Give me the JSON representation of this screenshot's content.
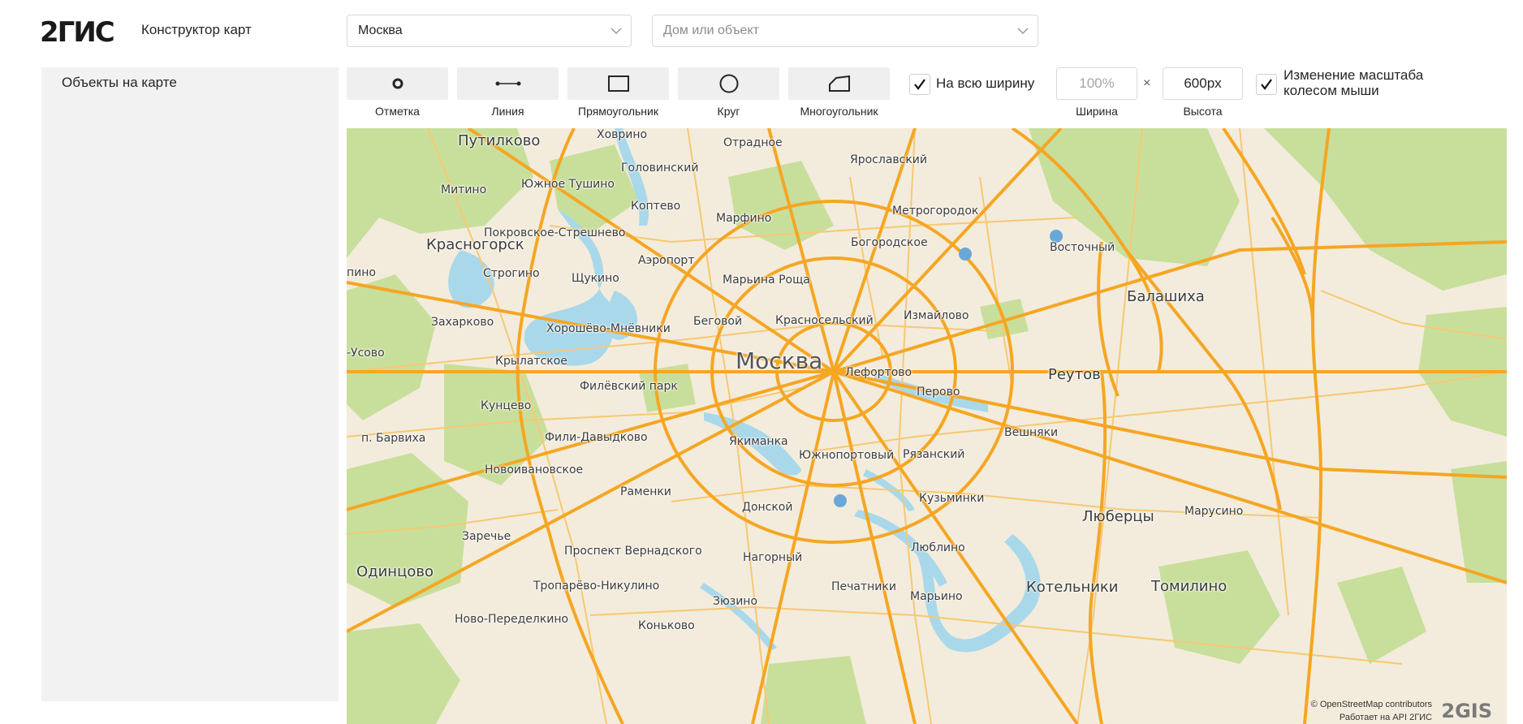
{
  "header": {
    "logo": "2ГИС",
    "app_title": "Конструктор карт",
    "city_select_value": "Москва",
    "object_search_placeholder": "Дом или объект"
  },
  "sidebar": {
    "title": "Объекты на карте"
  },
  "toolbar": {
    "tools": [
      {
        "label": "Отметка",
        "icon": "point-icon"
      },
      {
        "label": "Линия",
        "icon": "line-icon"
      },
      {
        "label": "Прямоугольник",
        "icon": "rectangle-icon"
      },
      {
        "label": "Круг",
        "icon": "circle-icon"
      },
      {
        "label": "Многоугольник",
        "icon": "polygon-icon"
      }
    ],
    "full_width_label": "На всю ширину",
    "full_width_checked": true,
    "width_value": "100%",
    "width_label": "Ширина",
    "times": "×",
    "height_value": "600px",
    "height_label": "Высота",
    "scroll_zoom_label_line1": "Изменение масштаба",
    "scroll_zoom_label_line2": "колесом мыши",
    "scroll_zoom_checked": true
  },
  "map": {
    "labels": {
      "putilkovo": "Путилково",
      "khovrino": "Ховрино",
      "otradnoe": "Отрадное",
      "yaroslavsky": "Ярославский",
      "golovinsky": "Головинский",
      "yuzhnoe_tushino": "Южное Тушино",
      "mitino": "Митино",
      "koptevo": "Коптево",
      "marfino": "Марфино",
      "metrogorodok": "Метрогородок",
      "krasnogorsk": "Красногорск",
      "pokrovskoe": "Покровское-Стрешнево",
      "bogorodskoe": "Богородское",
      "vostochny": "Восточный",
      "aeroport": "Аэропорт",
      "pino": "пино",
      "strogino": "Строгино",
      "shchukino": "Щукино",
      "marina_roshcha": "Марьина Роща",
      "balashikha": "Балашиха",
      "izmaylovo": "Измайлово",
      "zakharkovo": "Захарково",
      "begovoy": "Беговой",
      "krasnoselsky": "Красносельский",
      "khoroshevo": "Хорошёво-Мнёвники",
      "usovo": "-Усово",
      "krylatskoe": "Крылатское",
      "moskva": "Москва",
      "lefortovo": "Лефортово",
      "reutov": "Реутов",
      "filevsky": "Филёвский парк",
      "perovo": "Перово",
      "kuntsevo": "Кунцево",
      "barvikha": "п. Барвиха",
      "fili": "Фили-Давыдково",
      "yakimanka": "Якиманка",
      "veshnyaki": "Вешняки",
      "yuzhnoportovy": "Южнопортовый",
      "ryazansky": "Рязанский",
      "novoivanovskoe": "Новоивановское",
      "ramenki": "Раменки",
      "kuzminki": "Кузьминки",
      "donskoy": "Донской",
      "lyubertsy": "Люберцы",
      "marusino": "Марусино",
      "zarechye": "Заречье",
      "lyublino": "Люблино",
      "vernadsky": "Проспект Вернадского",
      "nagorny": "Нагорный",
      "odintsovo": "Одинцово",
      "troparevo": "Тропарёво-Никулино",
      "pechatniki": "Печатники",
      "kotelniki": "Котельники",
      "tomilino": "Томилино",
      "zyuzino": "Зюзино",
      "maryino": "Марьино",
      "novo_peredelkino": "Ново-Переделкино",
      "konkovo": "Коньково"
    },
    "attribution": "© OpenStreetMap contributors",
    "attribution2": "Работает на API 2ГИС",
    "brand": "2GIS"
  },
  "colors": {
    "map_background": "#f3ecdc",
    "green": "#c8df9c",
    "water": "#a9d8ea",
    "major_road": "#f5a623",
    "minor_road": "#f7c873"
  }
}
